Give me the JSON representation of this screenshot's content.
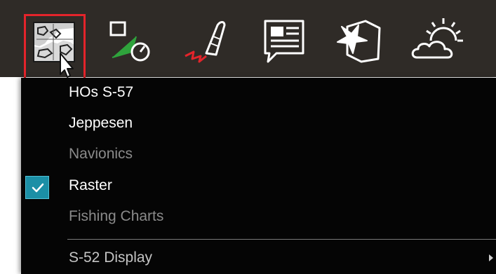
{
  "toolbar": {
    "buttons": [
      {
        "name": "charts-button",
        "icon": "chart-map-icon",
        "active": true
      },
      {
        "name": "navigation-button",
        "icon": "waypoint-navigation-icon",
        "active": false
      },
      {
        "name": "route-button",
        "icon": "boat-route-icon",
        "active": false
      },
      {
        "name": "info-button",
        "icon": "info-panel-icon",
        "active": false
      },
      {
        "name": "overlay-button",
        "icon": "overlay-star-icon",
        "active": false
      },
      {
        "name": "weather-button",
        "icon": "weather-sun-cloud-icon",
        "active": false
      }
    ],
    "background_color": "#2f2b27",
    "active_outline_color": "#e3242b"
  },
  "menu": {
    "items": [
      {
        "label": "HOs S-57",
        "enabled": true,
        "checked": false
      },
      {
        "label": "Jeppesen",
        "enabled": true,
        "checked": false
      },
      {
        "label": "Navionics",
        "enabled": false,
        "checked": false
      },
      {
        "label": "Raster",
        "enabled": true,
        "checked": true
      },
      {
        "label": "Fishing Charts",
        "enabled": false,
        "checked": false
      }
    ],
    "submenu": {
      "label": "S-52 Display",
      "has_submenu": true
    },
    "background_color": "#050505",
    "check_color": "#1b8fa6"
  }
}
